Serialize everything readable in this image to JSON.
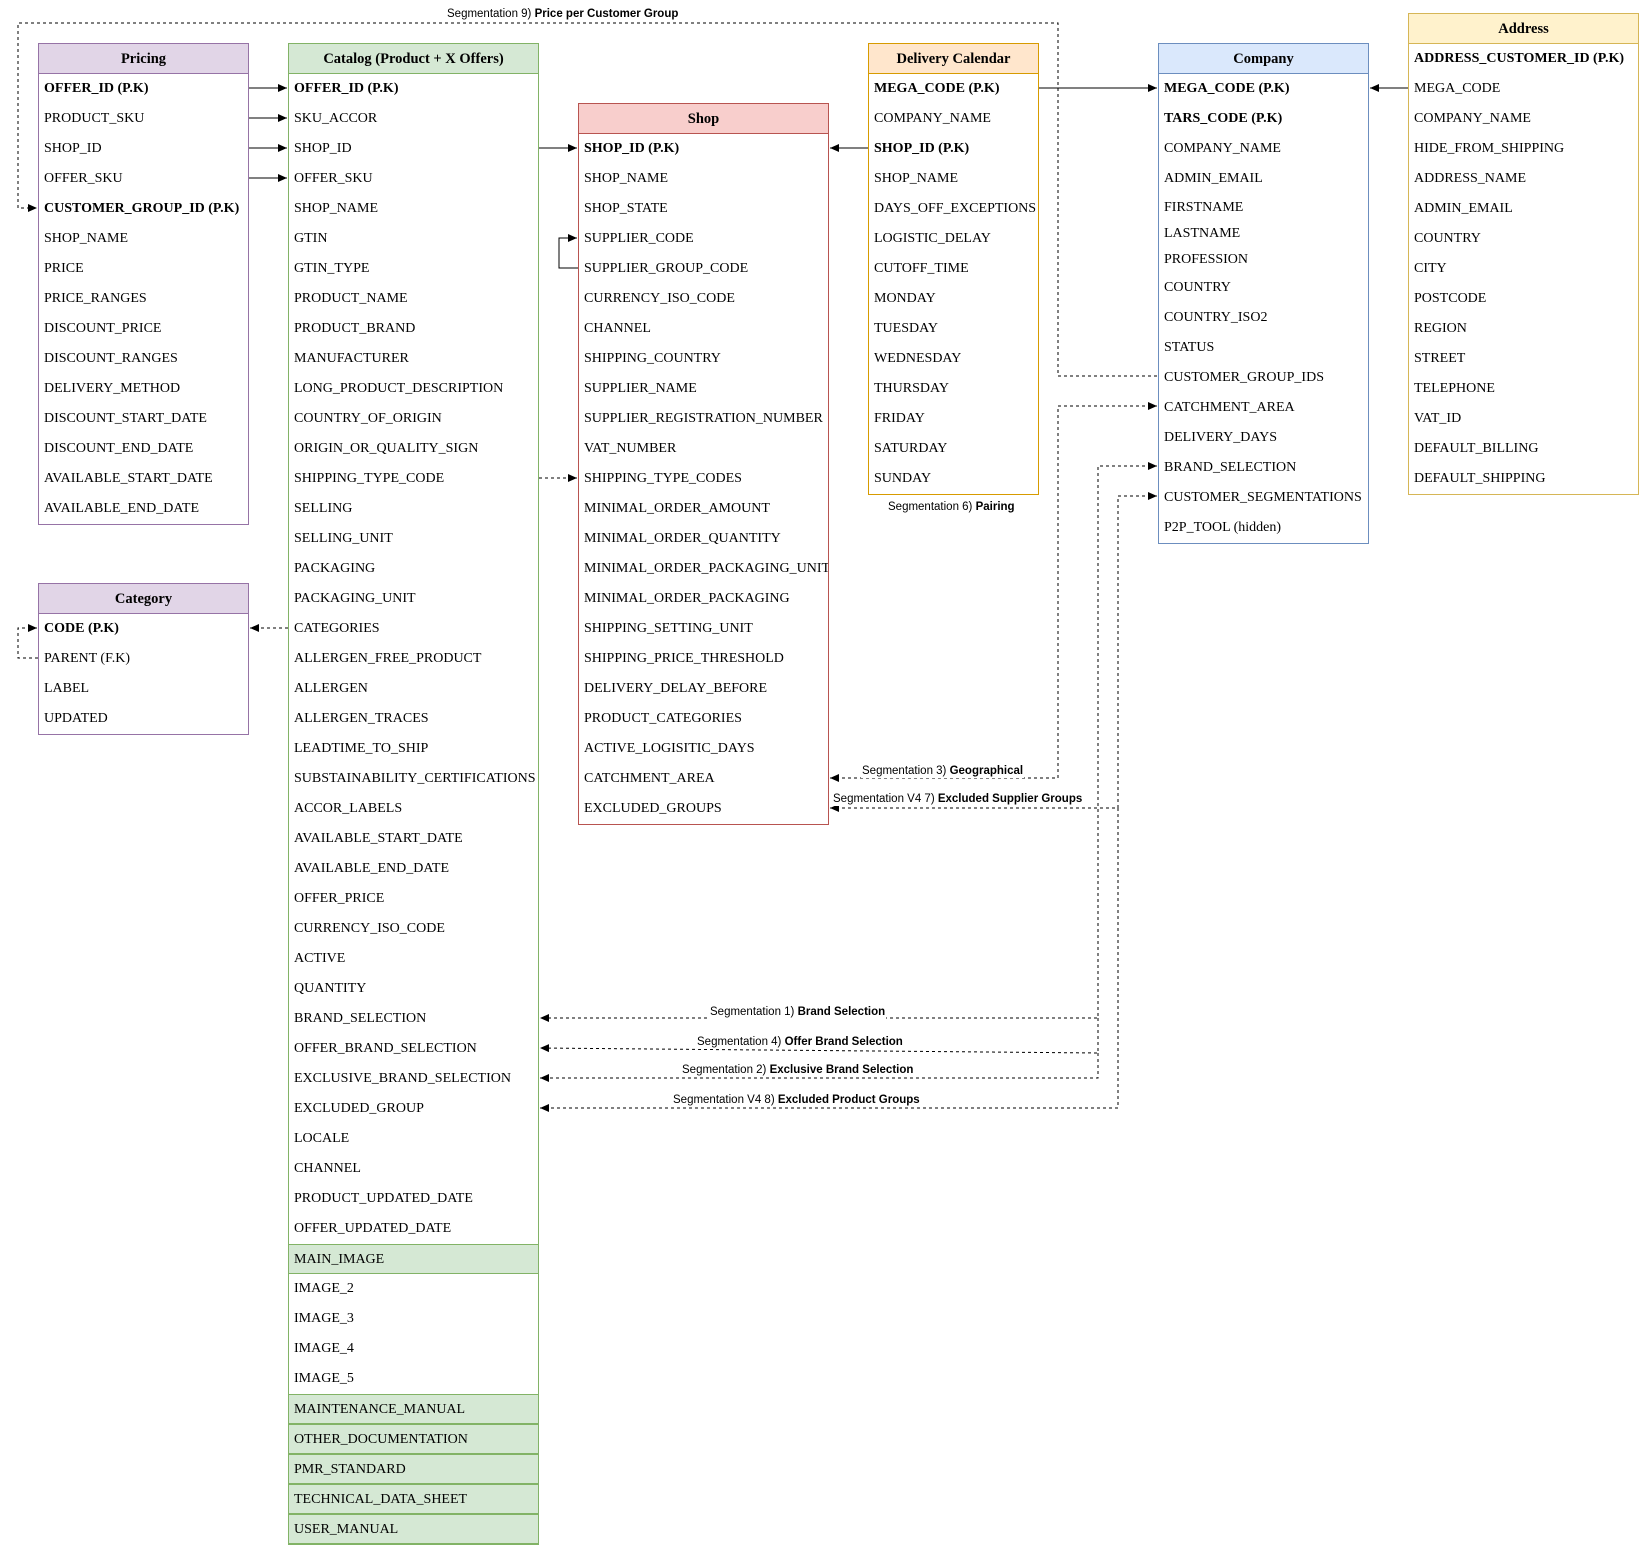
{
  "colors": {
    "pricing": {
      "fill": "#e1d5e7",
      "stroke": "#9673a6"
    },
    "catalog": {
      "fill": "#d5e8d4",
      "stroke": "#82b366"
    },
    "shop": {
      "fill": "#f8cecc",
      "stroke": "#b85450"
    },
    "delivery": {
      "fill": "#ffe6cc",
      "stroke": "#d79b00"
    },
    "company": {
      "fill": "#dae8fc",
      "stroke": "#6c8ebf"
    },
    "address": {
      "fill": "#fff2cc",
      "stroke": "#d6b656"
    },
    "category": {
      "fill": "#e1d5e7",
      "stroke": "#9673a6"
    },
    "edge": "#000000"
  },
  "tables": {
    "pricing": {
      "title": "Pricing",
      "fields": [
        "OFFER_ID (P.K)",
        "PRODUCT_SKU",
        "SHOP_ID",
        "OFFER_SKU",
        "CUSTOMER_GROUP_ID (P.K)",
        "SHOP_NAME",
        "PRICE",
        "PRICE_RANGES",
        "DISCOUNT_PRICE",
        "DISCOUNT_RANGES",
        "DELIVERY_METHOD",
        "DISCOUNT_START_DATE",
        "DISCOUNT_END_DATE",
        "AVAILABLE_START_DATE",
        "AVAILABLE_END_DATE"
      ]
    },
    "category": {
      "title": "Category",
      "fields": [
        "CODE (P.K)",
        "PARENT (F.K)",
        "LABEL",
        "UPDATED"
      ]
    },
    "catalog": {
      "title": "Catalog (Product + X Offers)",
      "fields": [
        "OFFER_ID (P.K)",
        "SKU_ACCOR",
        "SHOP_ID",
        "OFFER_SKU",
        "SHOP_NAME",
        "GTIN",
        "GTIN_TYPE",
        "PRODUCT_NAME",
        "PRODUCT_BRAND",
        "MANUFACTURER",
        "LONG_PRODUCT_DESCRIPTION",
        "COUNTRY_OF_ORIGIN",
        "ORIGIN_OR_QUALITY_SIGN",
        "SHIPPING_TYPE_CODE",
        "SELLING",
        "SELLING_UNIT",
        "PACKAGING",
        "PACKAGING_UNIT",
        "CATEGORIES",
        "ALLERGEN_FREE_PRODUCT",
        "ALLERGEN",
        "ALLERGEN_TRACES",
        "LEADTIME_TO_SHIP",
        "SUBSTAINABILITY_CERTIFICATIONS",
        "ACCOR_LABELS",
        "AVAILABLE_START_DATE",
        "AVAILABLE_END_DATE",
        "OFFER_PRICE",
        "CURRENCY_ISO_CODE",
        "ACTIVE",
        "QUANTITY",
        "BRAND_SELECTION",
        "OFFER_BRAND_SELECTION",
        "EXCLUSIVE_BRAND_SELECTION",
        "EXCLUDED_GROUP",
        "LOCALE",
        "CHANNEL",
        "PRODUCT_UPDATED_DATE",
        "OFFER_UPDATED_DATE",
        "MAIN_IMAGE",
        "IMAGE_2",
        "IMAGE_3",
        "IMAGE_4",
        "IMAGE_5",
        "MAINTENANCE_MANUAL",
        "OTHER_DOCUMENTATION",
        "PMR_STANDARD",
        "TECHNICAL_DATA_SHEET",
        "USER_MANUAL"
      ]
    },
    "shop": {
      "title": "Shop",
      "fields": [
        "SHOP_ID (P.K)",
        "SHOP_NAME",
        "SHOP_STATE",
        "SUPPLIER_CODE",
        "SUPPLIER_GROUP_CODE",
        "CURRENCY_ISO_CODE",
        "CHANNEL",
        "SHIPPING_COUNTRY",
        "SUPPLIER_NAME",
        "SUPPLIER_REGISTRATION_NUMBER",
        "VAT_NUMBER",
        "SHIPPING_TYPE_CODES",
        "MINIMAL_ORDER_AMOUNT",
        "MINIMAL_ORDER_QUANTITY",
        "MINIMAL_ORDER_PACKAGING_UNIT",
        "MINIMAL_ORDER_PACKAGING",
        "SHIPPING_SETTING_UNIT",
        "SHIPPING_PRICE_THRESHOLD",
        "DELIVERY_DELAY_BEFORE",
        "PRODUCT_CATEGORIES",
        "ACTIVE_LOGISITIC_DAYS",
        "CATCHMENT_AREA",
        "EXCLUDED_GROUPS"
      ]
    },
    "delivery": {
      "title": "Delivery Calendar",
      "fields": [
        "MEGA_CODE (P.K)",
        "COMPANY_NAME",
        "SHOP_ID (P.K)",
        "SHOP_NAME",
        "DAYS_OFF_EXCEPTIONS",
        "LOGISTIC_DELAY",
        "CUTOFF_TIME",
        "MONDAY",
        "TUESDAY",
        "WEDNESDAY",
        "THURSDAY",
        "FRIDAY",
        "SATURDAY",
        "SUNDAY"
      ]
    },
    "company": {
      "title": "Company",
      "fields": [
        "MEGA_CODE (P.K)",
        "TARS_CODE (P.K)",
        "COMPANY_NAME",
        "ADMIN_EMAIL",
        "FIRSTNAME",
        "LASTNAME",
        "PROFESSION",
        "COUNTRY",
        "COUNTRY_ISO2",
        "STATUS",
        "CUSTOMER_GROUP_IDS",
        "CATCHMENT_AREA",
        "DELIVERY_DAYS",
        "BRAND_SELECTION",
        "CUSTOMER_SEGMENTATIONS",
        "P2P_TOOL (hidden)"
      ]
    },
    "address": {
      "title": "Address",
      "fields": [
        "ADDRESS_CUSTOMER_ID (P.K)",
        "MEGA_CODE",
        "COMPANY_NAME",
        "HIDE_FROM_SHIPPING",
        "ADDRESS_NAME",
        "ADMIN_EMAIL",
        "COUNTRY",
        "CITY",
        "POSTCODE",
        "REGION",
        "STREET",
        "TELEPHONE",
        "VAT_ID",
        "DEFAULT_BILLING",
        "DEFAULT_SHIPPING"
      ]
    }
  },
  "labels": {
    "seg9": {
      "prefix": "Segmentation 9) ",
      "name": "Price per Customer Group"
    },
    "seg6": {
      "prefix": "Segmentation 6) ",
      "name": "Pairing"
    },
    "seg3": {
      "prefix": "Segmentation 3) ",
      "name": "Geographical"
    },
    "seg7": {
      "prefix": "Segmentation V4 7) ",
      "name": "Excluded Supplier Groups"
    },
    "seg1": {
      "prefix": "Segmentation 1) ",
      "name": "Brand Selection"
    },
    "seg4": {
      "prefix": "Segmentation 4) ",
      "name": "Offer Brand Selection"
    },
    "seg2": {
      "prefix": "Segmentation 2) ",
      "name": "Exclusive Brand Selection"
    },
    "seg8": {
      "prefix": "Segmentation V4 8) ",
      "name": "Excluded Product Groups"
    }
  }
}
